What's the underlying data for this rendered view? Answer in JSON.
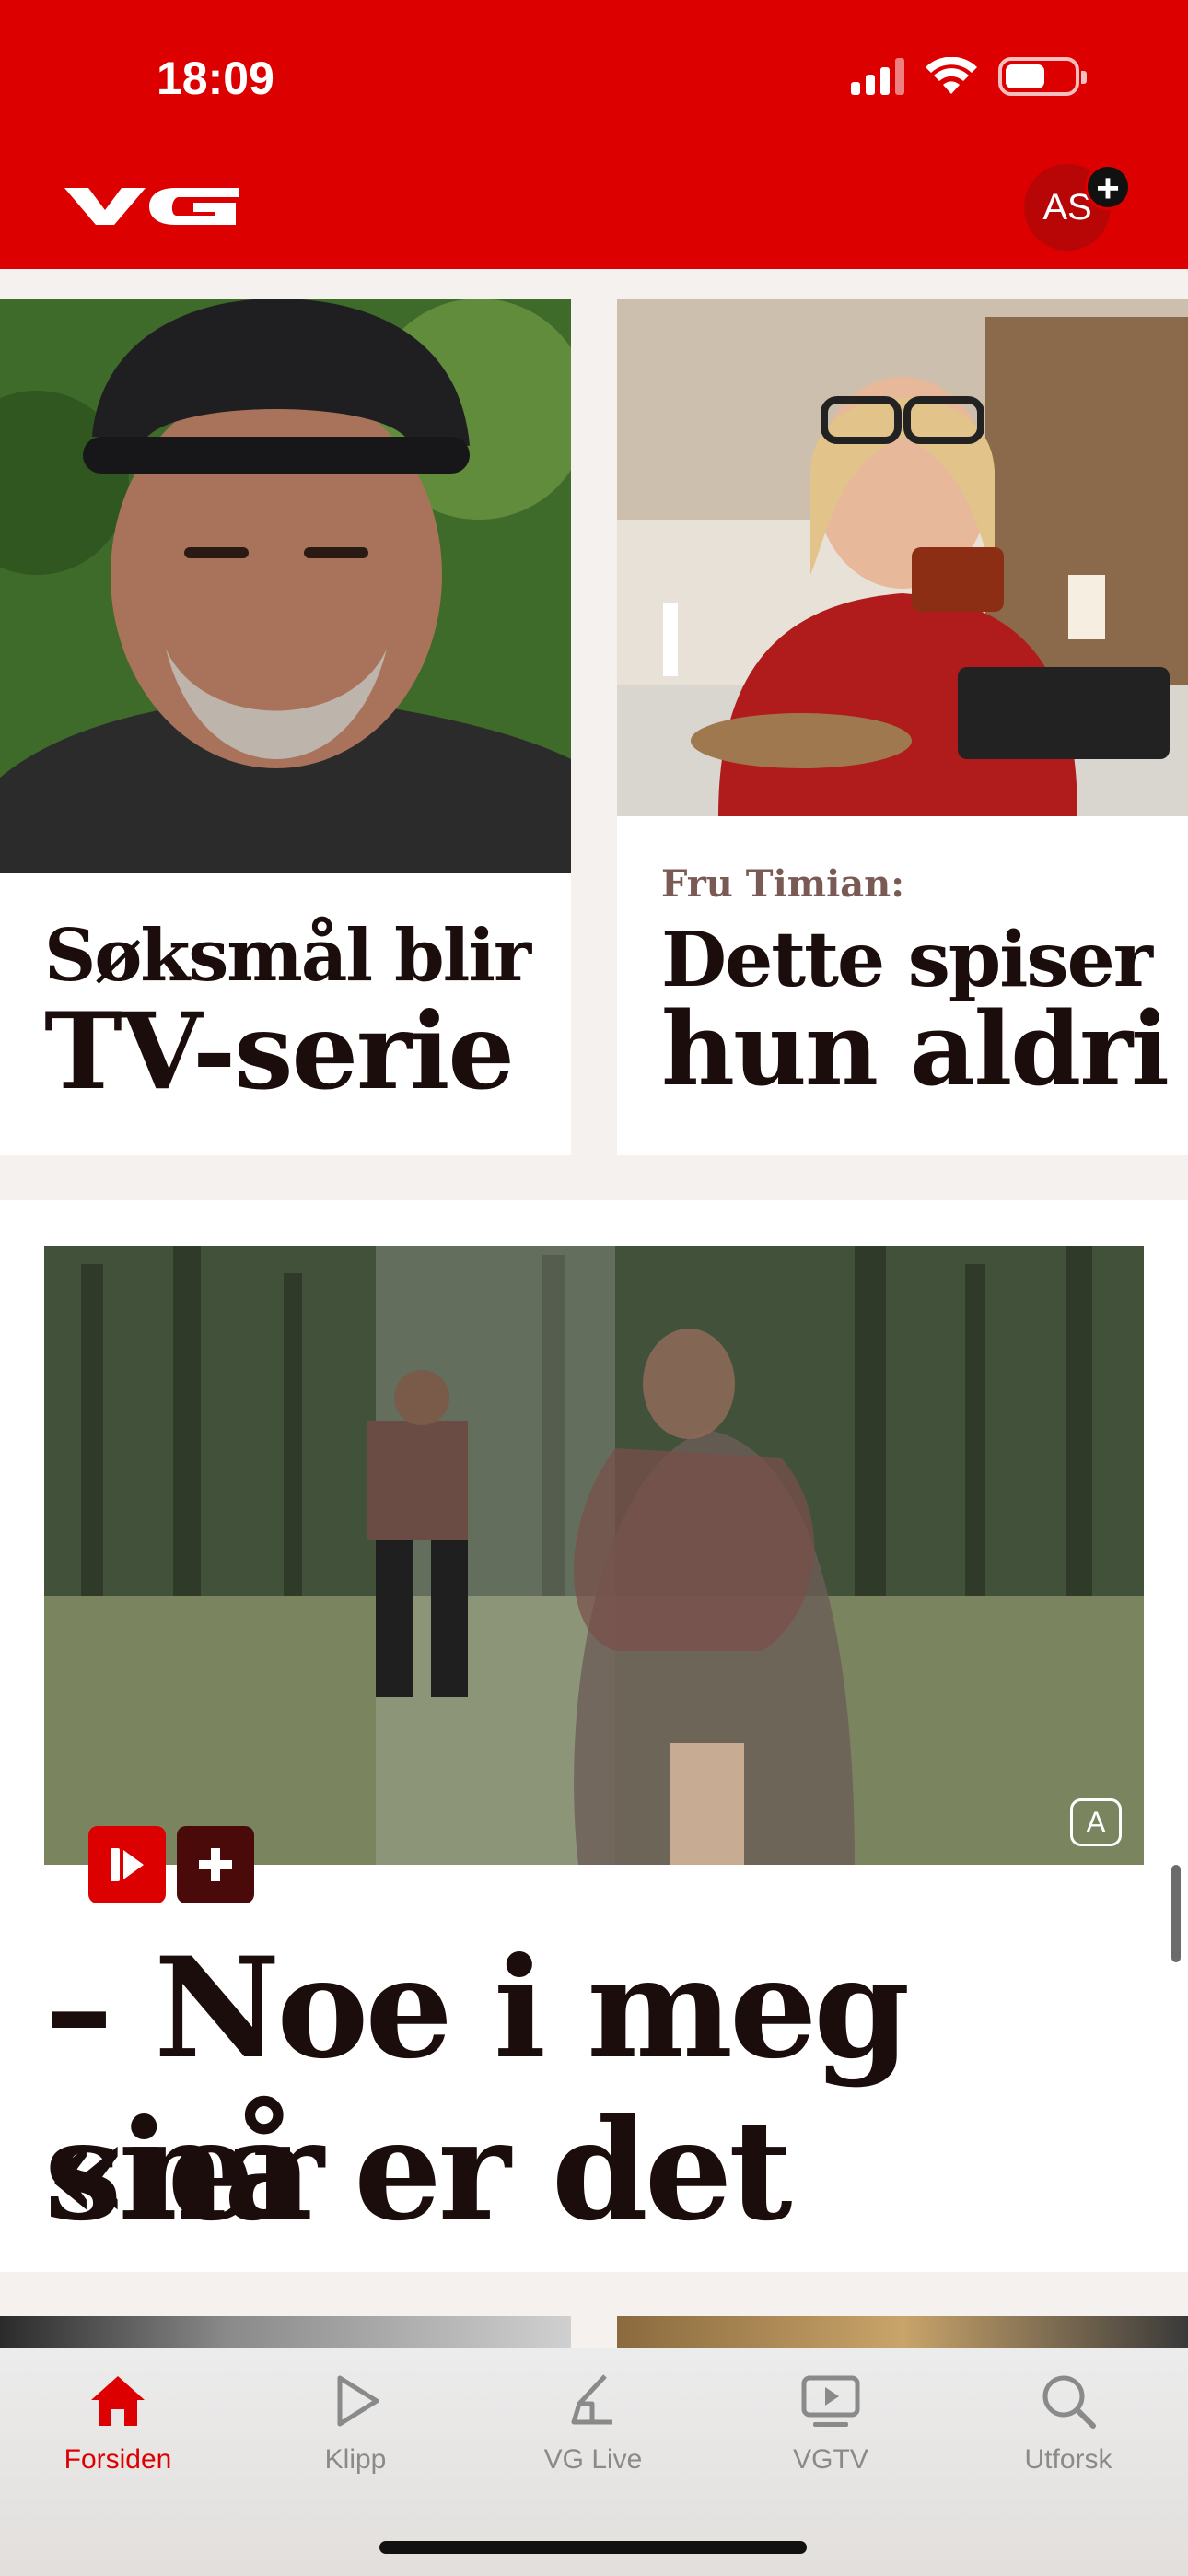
{
  "status_bar": {
    "time": "18:09"
  },
  "header": {
    "brand": "VG",
    "avatar_initials": "AS",
    "brand_color": "#dc0000"
  },
  "cards": [
    {
      "headline_line1": "Søksmål blir",
      "headline_line2": "TV-serie"
    },
    {
      "kicker": "Fru Timian:",
      "headline_line1": "Dette spiser",
      "headline_line2": "hun aldri"
    },
    {
      "headline_line1": "– Noe i meg sier",
      "headline_line2": "«nå er det nok»",
      "badge_letter": "A"
    }
  ],
  "tabbar": {
    "tabs": [
      {
        "label": "Forsiden",
        "icon": "home-icon",
        "active": true
      },
      {
        "label": "Klipp",
        "icon": "play-icon"
      },
      {
        "label": "VG Live",
        "icon": "vg-live-icon"
      },
      {
        "label": "VGTV",
        "icon": "vgtv-icon"
      },
      {
        "label": "Utforsk",
        "icon": "search-icon"
      }
    ]
  }
}
